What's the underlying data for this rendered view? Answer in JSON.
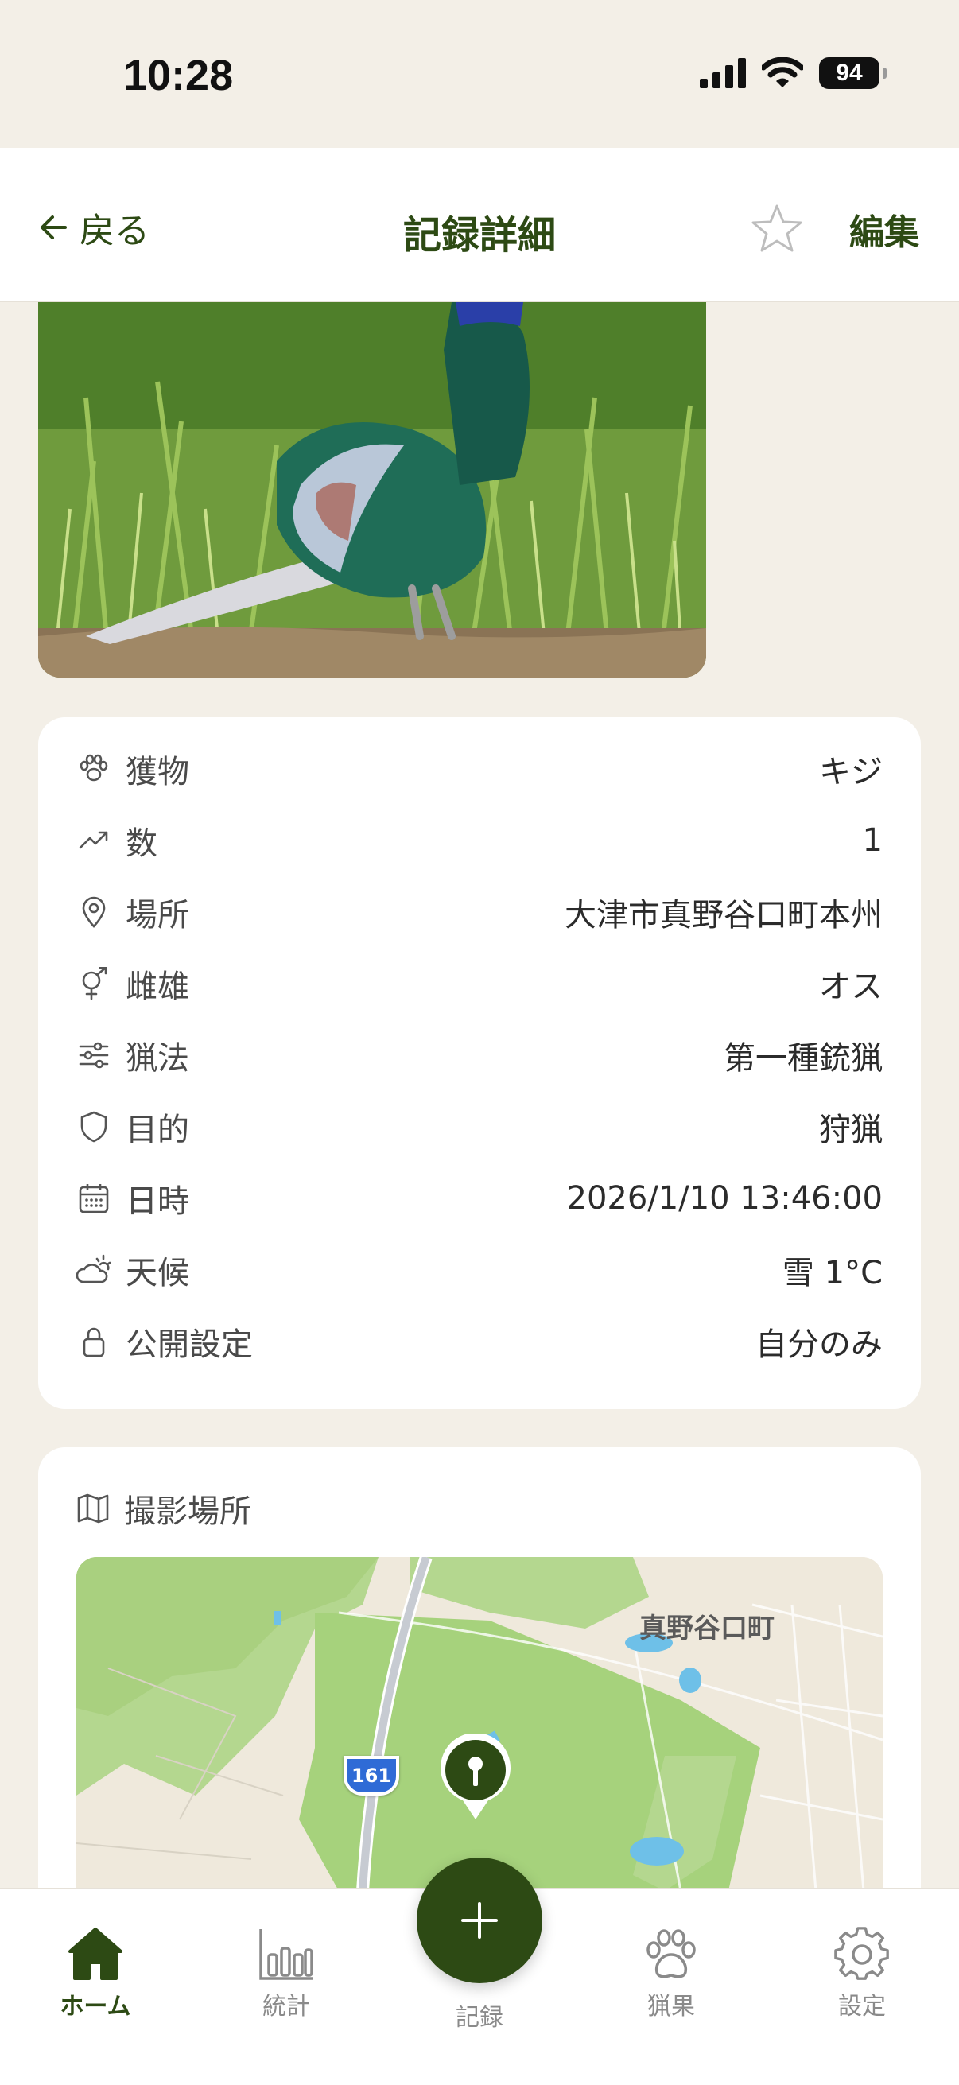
{
  "status_bar": {
    "time": "10:28",
    "battery": "94"
  },
  "header": {
    "back_label": "戻る",
    "title": "記録詳細",
    "edit_label": "編集"
  },
  "details": [
    {
      "icon": "paw-icon",
      "label": "獲物",
      "value": "キジ"
    },
    {
      "icon": "trend-up-icon",
      "label": "数",
      "value": "1"
    },
    {
      "icon": "map-pin-icon",
      "label": "場所",
      "value": "大津市真野谷口町本州"
    },
    {
      "icon": "gender-icon",
      "label": "雌雄",
      "value": "オス"
    },
    {
      "icon": "sliders-icon",
      "label": "猟法",
      "value": "第一種銃猟"
    },
    {
      "icon": "shield-icon",
      "label": "目的",
      "value": "狩猟"
    },
    {
      "icon": "calendar-icon",
      "label": "日時",
      "value": "2026/1/10 13:46:00"
    },
    {
      "icon": "weather-icon",
      "label": "天候",
      "value": "雪 1°C"
    },
    {
      "icon": "lock-icon",
      "label": "公開設定",
      "value": "自分のみ"
    }
  ],
  "map_section": {
    "title": "撮影場所",
    "place_label": "真野谷口町",
    "route_number": "161"
  },
  "tabs": [
    {
      "icon": "home-icon",
      "label": "ホーム",
      "active": true
    },
    {
      "icon": "bar-chart-icon",
      "label": "統計",
      "active": false
    },
    {
      "icon": "paw-icon",
      "label": "猟果",
      "active": false
    },
    {
      "icon": "gear-icon",
      "label": "設定",
      "active": false
    }
  ],
  "fab": {
    "label": "記録"
  },
  "colors": {
    "primary": "#2d4a14",
    "background": "#f3efe7",
    "card": "#ffffff"
  }
}
